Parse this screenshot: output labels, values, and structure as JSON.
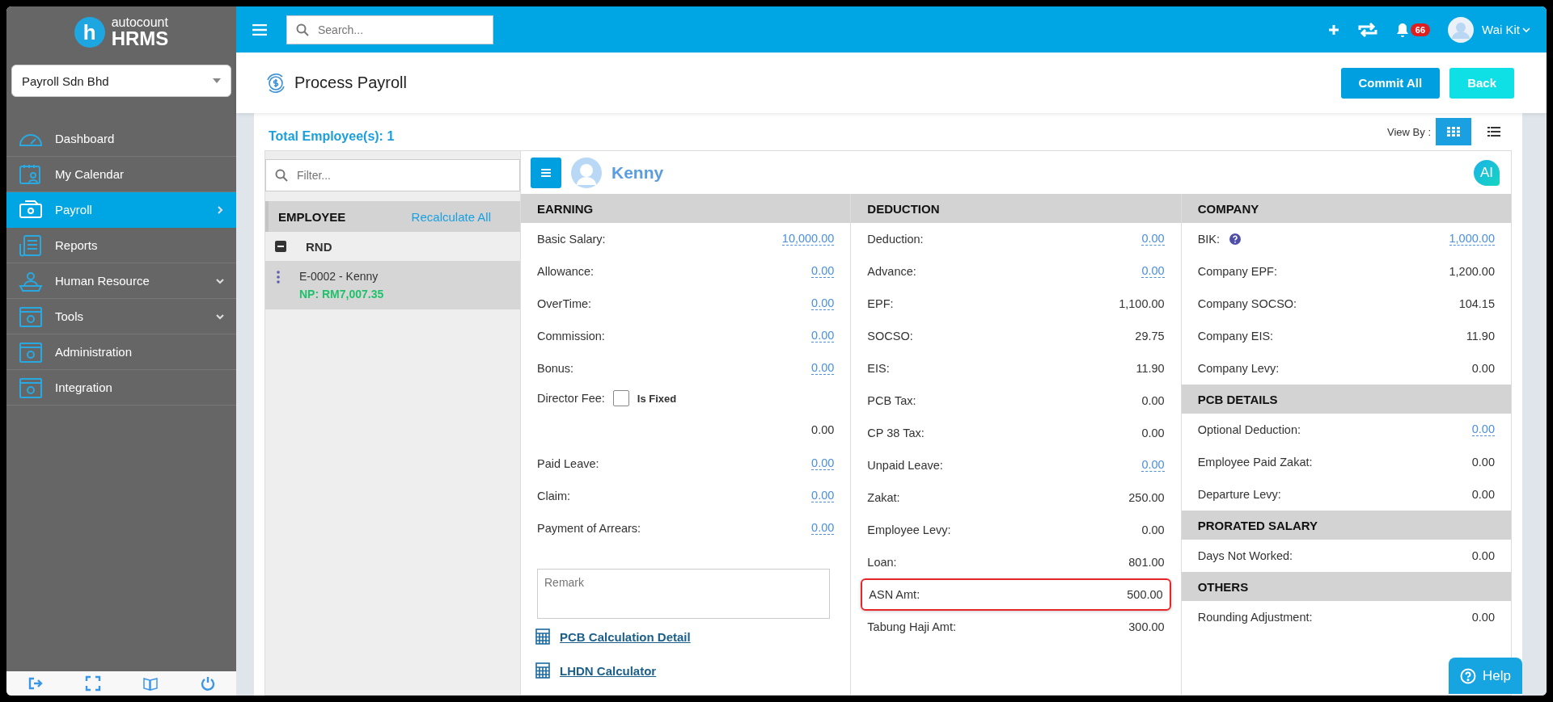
{
  "sidebar": {
    "logo": {
      "badge": "h",
      "brand": "autocount",
      "product": "HRMS"
    },
    "company_select": {
      "value": "Payroll Sdn Bhd"
    },
    "items": [
      {
        "label": "Dashboard",
        "selected": false,
        "has_submenu": false
      },
      {
        "label": "My Calendar",
        "selected": false,
        "has_submenu": false
      },
      {
        "label": "Payroll",
        "selected": true,
        "has_submenu": true
      },
      {
        "label": "Reports",
        "selected": false,
        "has_submenu": false
      },
      {
        "label": "Human Resource",
        "selected": false,
        "has_submenu": true
      },
      {
        "label": "Tools",
        "selected": false,
        "has_submenu": true
      },
      {
        "label": "Administration",
        "selected": false,
        "has_submenu": false
      },
      {
        "label": "Integration",
        "selected": false,
        "has_submenu": false
      }
    ]
  },
  "topbar": {
    "search": {
      "placeholder": "Search..."
    },
    "notifications": "66",
    "user": "Wai Kit"
  },
  "header": {
    "title": "Process Payroll",
    "buttons": [
      {
        "label": "Commit All",
        "kind": "primary"
      },
      {
        "label": "Back",
        "kind": "secondary"
      }
    ]
  },
  "summary": {
    "total": "Total Employee(s): 1",
    "view_by": "View By :",
    "view_modes": [
      {
        "kind": "grid",
        "selected": true
      },
      {
        "kind": "list",
        "selected": false
      }
    ]
  },
  "employee_list": {
    "filter": {
      "placeholder": "Filter..."
    },
    "heading": "EMPLOYEE",
    "action": "Recalculate All",
    "groups": [
      {
        "name": "RND",
        "expanded": true,
        "employees": [
          {
            "name": "E-0002 - Kenny",
            "net_pay": "NP: RM7,007.35",
            "selected": true
          }
        ]
      }
    ]
  },
  "employee": {
    "name": "Kenny",
    "ai_badge": "AI"
  },
  "earning": {
    "title": "EARNING",
    "rows": [
      {
        "kind": "amount",
        "label": "Basic Salary:",
        "value": "10,000.00",
        "editable": true
      },
      {
        "kind": "amount",
        "label": "Allowance:",
        "value": "0.00",
        "editable": true
      },
      {
        "kind": "amount",
        "label": "OverTime:",
        "value": "0.00",
        "editable": true
      },
      {
        "kind": "amount",
        "label": "Commission:",
        "value": "0.00",
        "editable": true
      },
      {
        "kind": "amount",
        "label": "Bonus:",
        "value": "0.00",
        "editable": true
      },
      {
        "kind": "checkbox",
        "label": "Director Fee:",
        "option": "Is Fixed",
        "checked": false,
        "value": "0.00",
        "editable": false
      },
      {
        "kind": "amount",
        "label": "Paid Leave:",
        "value": "0.00",
        "editable": true
      },
      {
        "kind": "amount",
        "label": "Claim:",
        "value": "0.00",
        "editable": true
      },
      {
        "kind": "amount",
        "label": "Payment of Arrears:",
        "value": "0.00",
        "editable": true
      }
    ],
    "remark": {
      "placeholder": "Remark"
    },
    "links": [
      "PCB Calculation Detail",
      "LHDN Calculator"
    ]
  },
  "deduction": {
    "title": "DEDUCTION",
    "rows": [
      {
        "label": "Deduction:",
        "value": "0.00",
        "editable": true,
        "highlighted": false
      },
      {
        "label": "Advance:",
        "value": "0.00",
        "editable": true,
        "highlighted": false
      },
      {
        "label": "EPF:",
        "value": "1,100.00",
        "editable": false,
        "highlighted": false
      },
      {
        "label": "SOCSO:",
        "value": "29.75",
        "editable": false,
        "highlighted": false
      },
      {
        "label": "EIS:",
        "value": "11.90",
        "editable": false,
        "highlighted": false
      },
      {
        "label": "PCB Tax:",
        "value": "0.00",
        "editable": false,
        "highlighted": false
      },
      {
        "label": "CP 38 Tax:",
        "value": "0.00",
        "editable": false,
        "highlighted": false
      },
      {
        "label": "Unpaid Leave:",
        "value": "0.00",
        "editable": true,
        "highlighted": false
      },
      {
        "label": "Zakat:",
        "value": "250.00",
        "editable": false,
        "highlighted": false
      },
      {
        "label": "Employee Levy:",
        "value": "0.00",
        "editable": false,
        "highlighted": false
      },
      {
        "label": "Loan:",
        "value": "801.00",
        "editable": false,
        "highlighted": false
      },
      {
        "label": "ASN Amt:",
        "value": "500.00",
        "editable": false,
        "highlighted": true
      },
      {
        "label": "Tabung Haji Amt:",
        "value": "300.00",
        "editable": false,
        "highlighted": false
      }
    ]
  },
  "company_sections": [
    {
      "title": "COMPANY",
      "rows": [
        {
          "label": "BIK:",
          "value": "1,000.00",
          "editable": true,
          "help": true
        },
        {
          "label": "Company EPF:",
          "value": "1,200.00",
          "editable": false
        },
        {
          "label": "Company SOCSO:",
          "value": "104.15",
          "editable": false
        },
        {
          "label": "Company EIS:",
          "value": "11.90",
          "editable": false
        },
        {
          "label": "Company Levy:",
          "value": "0.00",
          "editable": false
        }
      ]
    },
    {
      "title": "PCB DETAILS",
      "rows": [
        {
          "label": "Optional Deduction:",
          "value": "0.00",
          "editable": true
        },
        {
          "label": "Employee Paid Zakat:",
          "value": "0.00",
          "editable": false
        },
        {
          "label": "Departure Levy:",
          "value": "0.00",
          "editable": false
        }
      ]
    },
    {
      "title": "PRORATED SALARY",
      "rows": [
        {
          "label": "Days Not Worked:",
          "value": "0.00",
          "editable": false
        }
      ]
    },
    {
      "title": "OTHERS",
      "rows": [
        {
          "label": "Rounding Adjustment:",
          "value": "0.00",
          "editable": false
        }
      ]
    }
  ],
  "help_button": {
    "label": "Help"
  }
}
